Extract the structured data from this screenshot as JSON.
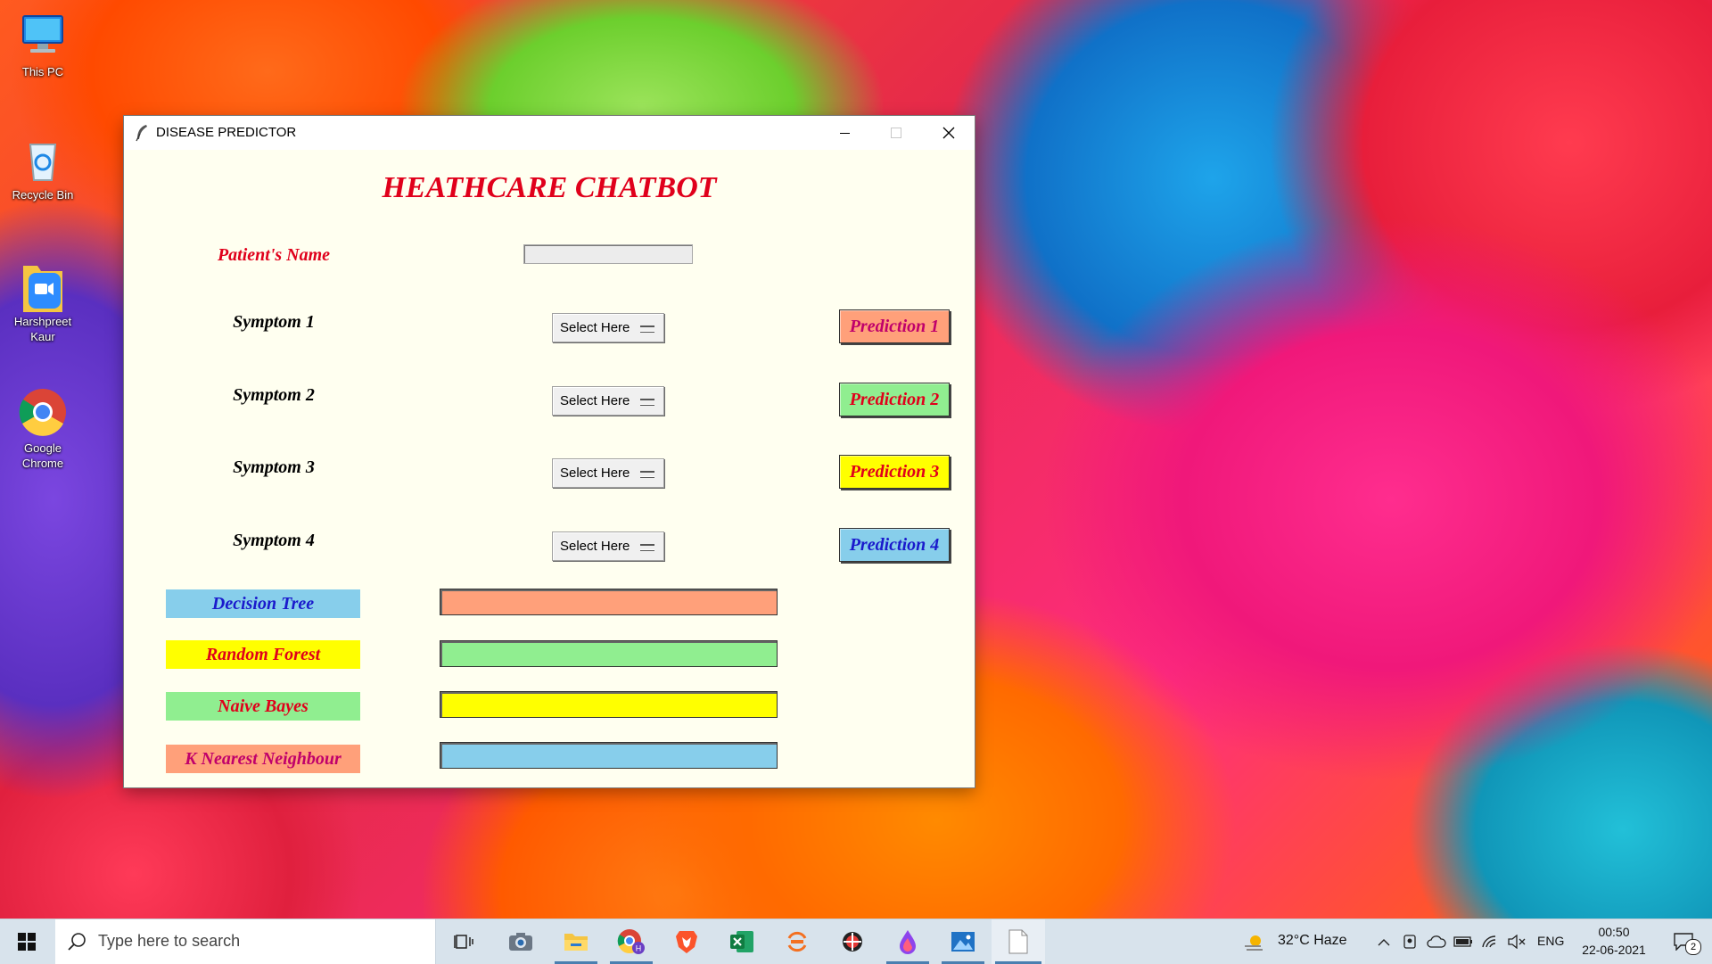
{
  "desktop": {
    "icons": [
      {
        "label": "This PC",
        "icon": "computer-icon"
      },
      {
        "label": "Recycle Bin",
        "icon": "recycle-bin-icon"
      },
      {
        "label": "Harshpreet Kaur",
        "icon": "zoom-folder-icon"
      },
      {
        "label": "Google Chrome",
        "icon": "chrome-icon"
      }
    ]
  },
  "window": {
    "title": "DISEASE PREDICTOR",
    "icon": "feather-icon",
    "heading": "HEATHCARE CHATBOT",
    "patient_label": "Patient's Name",
    "patient_value": "",
    "symptoms": [
      {
        "label": "Symptom 1",
        "selected": "Select Here"
      },
      {
        "label": "Symptom 2",
        "selected": "Select Here"
      },
      {
        "label": "Symptom 3",
        "selected": "Select Here"
      },
      {
        "label": "Symptom 4",
        "selected": "Select Here"
      }
    ],
    "predictions": [
      {
        "label": "Prediction 1",
        "bg": "#ffa07a",
        "fg": "#c0006b"
      },
      {
        "label": "Prediction 2",
        "bg": "#90ee90",
        "fg": "#e0001b"
      },
      {
        "label": "Prediction 3",
        "bg": "#ffff00",
        "fg": "#e0001b"
      },
      {
        "label": "Prediction 4",
        "bg": "#87ceeb",
        "fg": "#1a1acc"
      }
    ],
    "algorithms": [
      {
        "label": "Decision Tree",
        "bg": "#87ceeb",
        "fg": "#1a1acc",
        "result_bg": "#ffa07a",
        "result": ""
      },
      {
        "label": "Random Forest",
        "bg": "#ffff00",
        "fg": "#e0001b",
        "result_bg": "#90ee90",
        "result": ""
      },
      {
        "label": "Naive Bayes",
        "bg": "#90ee90",
        "fg": "#e0001b",
        "result_bg": "#ffff00",
        "result": ""
      },
      {
        "label": "K Nearest Neighbour",
        "bg": "#ffa07a",
        "fg": "#c0006b",
        "result_bg": "#87ceeb",
        "result": ""
      }
    ],
    "colors": {
      "background": "#fffff0",
      "heading": "#e0001b",
      "patient_label": "#e0001b",
      "symptom_label": "#000000"
    }
  },
  "taskbar": {
    "search_placeholder": "Type here to search",
    "weather": "32°C  Haze",
    "language": "ENG",
    "time": "00:50",
    "date": "22-06-2021",
    "notification_count": "2",
    "apps": [
      "task-view-icon",
      "camera-icon",
      "file-explorer-icon",
      "chrome-profile-icon",
      "brave-icon",
      "excel-icon",
      "sync-app-icon",
      "app-icon",
      "droplet-app-icon",
      "photos-icon",
      "blank-document-icon"
    ]
  }
}
